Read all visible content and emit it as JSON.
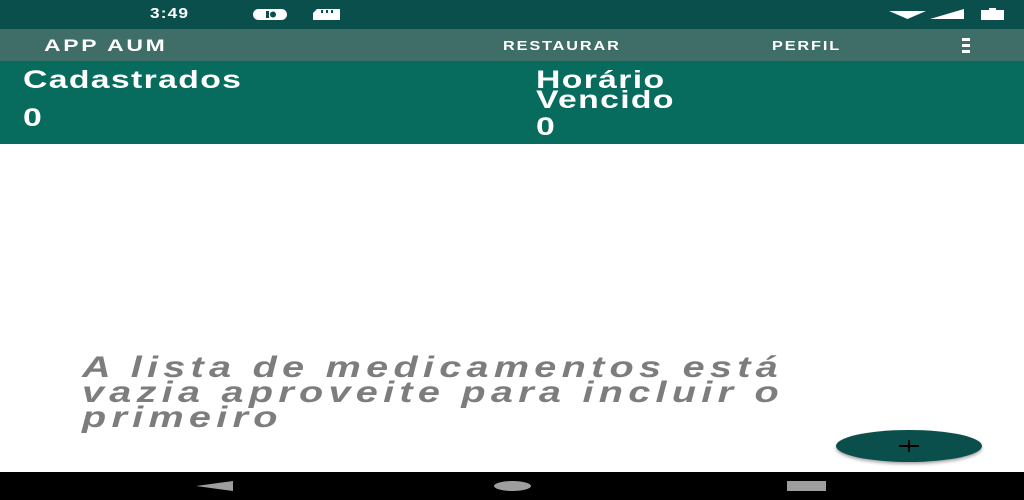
{
  "status_bar": {
    "time": "3:49",
    "icons": [
      "media-icon",
      "sd-card-icon",
      "wifi-icon",
      "signal-icon",
      "battery-icon"
    ]
  },
  "app_bar": {
    "title": "APP AUM",
    "actions": [
      "RESTAURAR",
      "PERFIL"
    ],
    "overflow_icon": "more-vert-icon"
  },
  "counters": {
    "registered": {
      "label": "Cadastrados",
      "value": "0"
    },
    "expired": {
      "label_line1": "Horário",
      "label_line2": "Vencido",
      "value": "0"
    }
  },
  "empty_state": {
    "message": "A lista de medicamentos está vazia aproveite para incluir o primeiro"
  },
  "fab": {
    "icon": "plus-icon"
  },
  "nav_bar": {
    "icons": [
      "back-icon",
      "home-icon",
      "recents-icon"
    ]
  },
  "colors": {
    "status_bar": "#0a4f4c",
    "app_bar": "#3f6d67",
    "counters_panel": "#076b5e",
    "fab": "#0a4f4c",
    "message_text": "#7d7d7d"
  }
}
